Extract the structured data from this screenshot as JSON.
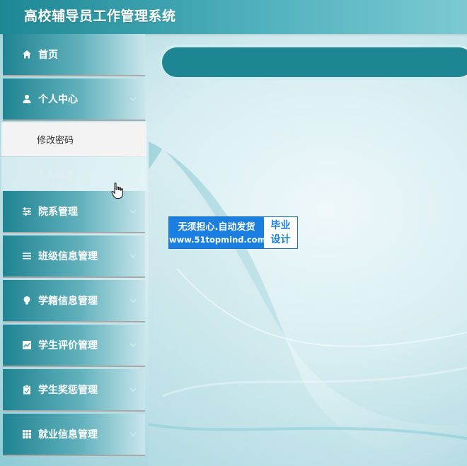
{
  "app": {
    "title": "高校辅导员工作管理系统"
  },
  "sidebar": {
    "items": [
      {
        "label": "首页",
        "icon": "home-icon"
      },
      {
        "label": "个人中心",
        "icon": "user-icon",
        "expanded": true,
        "children": [
          {
            "label": "修改密码"
          },
          {
            "label": "个人信息"
          }
        ]
      },
      {
        "label": "院系管理",
        "icon": "sliders-icon"
      },
      {
        "label": "班级信息管理",
        "icon": "list-icon"
      },
      {
        "label": "学籍信息管理",
        "icon": "bulb-icon"
      },
      {
        "label": "学生评价管理",
        "icon": "chart-icon"
      },
      {
        "label": "学生奖惩管理",
        "icon": "clipboard-icon"
      },
      {
        "label": "就业信息管理",
        "icon": "grid-icon"
      }
    ]
  },
  "watermark": {
    "line1": "无须担心.自动发货",
    "line2": "www.51topmind.com",
    "side_top": "毕业",
    "side_bottom": "设计"
  },
  "colors": {
    "header": "#1d8794",
    "sidebar": "#1f8391",
    "breadcrumb": "#1e8593",
    "submenu_active": "#f3f3f3"
  }
}
